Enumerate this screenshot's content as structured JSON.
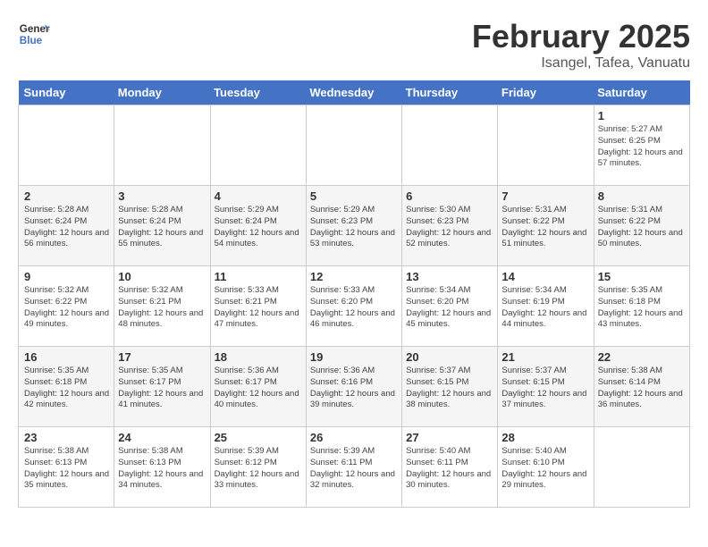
{
  "header": {
    "logo_general": "General",
    "logo_blue": "Blue",
    "month_year": "February 2025",
    "location": "Isangel, Tafea, Vanuatu"
  },
  "days_of_week": [
    "Sunday",
    "Monday",
    "Tuesday",
    "Wednesday",
    "Thursday",
    "Friday",
    "Saturday"
  ],
  "weeks": [
    [
      {
        "day": "",
        "info": ""
      },
      {
        "day": "",
        "info": ""
      },
      {
        "day": "",
        "info": ""
      },
      {
        "day": "",
        "info": ""
      },
      {
        "day": "",
        "info": ""
      },
      {
        "day": "",
        "info": ""
      },
      {
        "day": "1",
        "info": "Sunrise: 5:27 AM\nSunset: 6:25 PM\nDaylight: 12 hours and 57 minutes."
      }
    ],
    [
      {
        "day": "2",
        "info": "Sunrise: 5:28 AM\nSunset: 6:24 PM\nDaylight: 12 hours and 56 minutes."
      },
      {
        "day": "3",
        "info": "Sunrise: 5:28 AM\nSunset: 6:24 PM\nDaylight: 12 hours and 55 minutes."
      },
      {
        "day": "4",
        "info": "Sunrise: 5:29 AM\nSunset: 6:24 PM\nDaylight: 12 hours and 54 minutes."
      },
      {
        "day": "5",
        "info": "Sunrise: 5:29 AM\nSunset: 6:23 PM\nDaylight: 12 hours and 53 minutes."
      },
      {
        "day": "6",
        "info": "Sunrise: 5:30 AM\nSunset: 6:23 PM\nDaylight: 12 hours and 52 minutes."
      },
      {
        "day": "7",
        "info": "Sunrise: 5:31 AM\nSunset: 6:22 PM\nDaylight: 12 hours and 51 minutes."
      },
      {
        "day": "8",
        "info": "Sunrise: 5:31 AM\nSunset: 6:22 PM\nDaylight: 12 hours and 50 minutes."
      }
    ],
    [
      {
        "day": "9",
        "info": "Sunrise: 5:32 AM\nSunset: 6:22 PM\nDaylight: 12 hours and 49 minutes."
      },
      {
        "day": "10",
        "info": "Sunrise: 5:32 AM\nSunset: 6:21 PM\nDaylight: 12 hours and 48 minutes."
      },
      {
        "day": "11",
        "info": "Sunrise: 5:33 AM\nSunset: 6:21 PM\nDaylight: 12 hours and 47 minutes."
      },
      {
        "day": "12",
        "info": "Sunrise: 5:33 AM\nSunset: 6:20 PM\nDaylight: 12 hours and 46 minutes."
      },
      {
        "day": "13",
        "info": "Sunrise: 5:34 AM\nSunset: 6:20 PM\nDaylight: 12 hours and 45 minutes."
      },
      {
        "day": "14",
        "info": "Sunrise: 5:34 AM\nSunset: 6:19 PM\nDaylight: 12 hours and 44 minutes."
      },
      {
        "day": "15",
        "info": "Sunrise: 5:35 AM\nSunset: 6:18 PM\nDaylight: 12 hours and 43 minutes."
      }
    ],
    [
      {
        "day": "16",
        "info": "Sunrise: 5:35 AM\nSunset: 6:18 PM\nDaylight: 12 hours and 42 minutes."
      },
      {
        "day": "17",
        "info": "Sunrise: 5:35 AM\nSunset: 6:17 PM\nDaylight: 12 hours and 41 minutes."
      },
      {
        "day": "18",
        "info": "Sunrise: 5:36 AM\nSunset: 6:17 PM\nDaylight: 12 hours and 40 minutes."
      },
      {
        "day": "19",
        "info": "Sunrise: 5:36 AM\nSunset: 6:16 PM\nDaylight: 12 hours and 39 minutes."
      },
      {
        "day": "20",
        "info": "Sunrise: 5:37 AM\nSunset: 6:15 PM\nDaylight: 12 hours and 38 minutes."
      },
      {
        "day": "21",
        "info": "Sunrise: 5:37 AM\nSunset: 6:15 PM\nDaylight: 12 hours and 37 minutes."
      },
      {
        "day": "22",
        "info": "Sunrise: 5:38 AM\nSunset: 6:14 PM\nDaylight: 12 hours and 36 minutes."
      }
    ],
    [
      {
        "day": "23",
        "info": "Sunrise: 5:38 AM\nSunset: 6:13 PM\nDaylight: 12 hours and 35 minutes."
      },
      {
        "day": "24",
        "info": "Sunrise: 5:38 AM\nSunset: 6:13 PM\nDaylight: 12 hours and 34 minutes."
      },
      {
        "day": "25",
        "info": "Sunrise: 5:39 AM\nSunset: 6:12 PM\nDaylight: 12 hours and 33 minutes."
      },
      {
        "day": "26",
        "info": "Sunrise: 5:39 AM\nSunset: 6:11 PM\nDaylight: 12 hours and 32 minutes."
      },
      {
        "day": "27",
        "info": "Sunrise: 5:40 AM\nSunset: 6:11 PM\nDaylight: 12 hours and 30 minutes."
      },
      {
        "day": "28",
        "info": "Sunrise: 5:40 AM\nSunset: 6:10 PM\nDaylight: 12 hours and 29 minutes."
      },
      {
        "day": "",
        "info": ""
      }
    ]
  ]
}
